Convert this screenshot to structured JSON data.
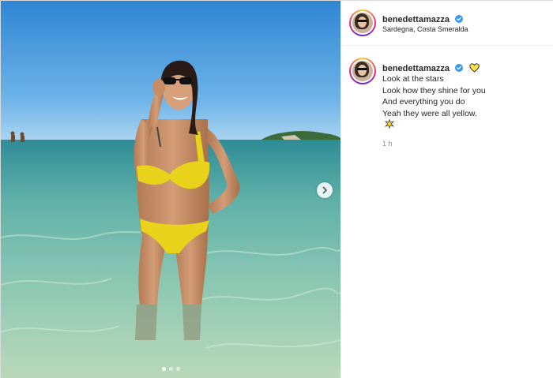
{
  "post": {
    "author": {
      "username": "benedettamazza",
      "verified": true,
      "location": "Sardegna, Costa Smeralda"
    },
    "media": {
      "carousel_total": 3,
      "carousel_active_index": 1,
      "next_button": "chevron-right-icon"
    },
    "caption": {
      "username": "benedettamazza",
      "verified": true,
      "heart_emoji": "yellow-heart-icon",
      "lines": [
        "Look at the stars",
        "Look how they shine for you",
        "And everything you do",
        "Yeah they were all yellow."
      ],
      "trailing_emoji": "sparkle-star-icon",
      "time_ago": "1 h"
    },
    "colors": {
      "verified_blue": "#3897f0",
      "heart_yellow": "#fde047",
      "muted_text": "#8e8e8e"
    }
  }
}
